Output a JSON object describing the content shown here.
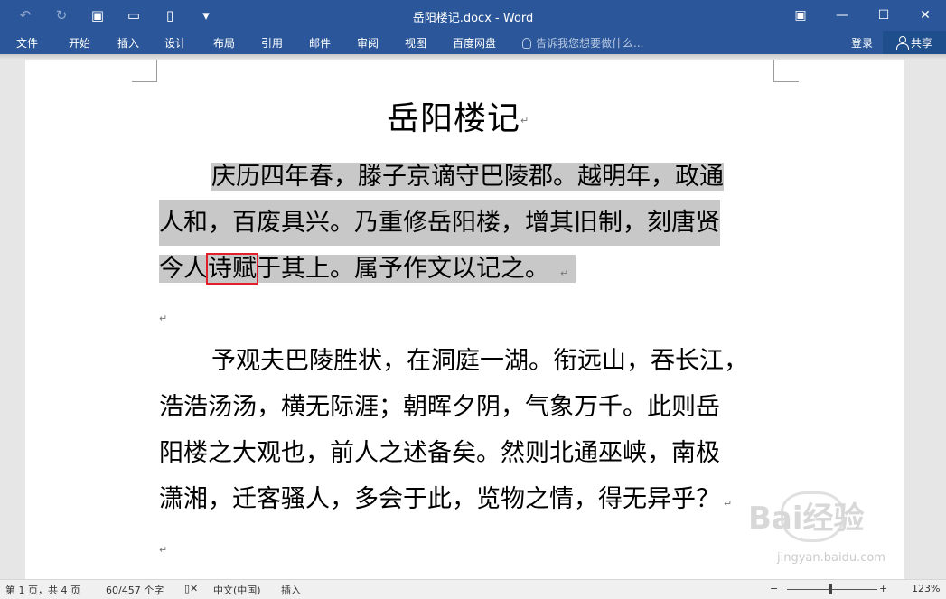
{
  "window": {
    "title": "岳阳楼记.docx - Word",
    "qat": [
      {
        "name": "undo-icon",
        "glyph": "↶"
      },
      {
        "name": "redo-icon",
        "glyph": "↻"
      },
      {
        "name": "save-icon",
        "glyph": "▣"
      },
      {
        "name": "open-folder-icon",
        "glyph": "▭"
      },
      {
        "name": "new-document-icon",
        "glyph": "▯"
      },
      {
        "name": "customize-qat-icon",
        "glyph": "▾"
      }
    ],
    "controls": [
      {
        "name": "ribbon-display-options-icon",
        "glyph": "▣"
      },
      {
        "name": "minimize-icon",
        "glyph": "—"
      },
      {
        "name": "maximize-icon",
        "glyph": "☐"
      },
      {
        "name": "close-icon",
        "glyph": "✕"
      }
    ]
  },
  "ribbon": {
    "tabs": [
      "文件",
      "开始",
      "插入",
      "设计",
      "布局",
      "引用",
      "邮件",
      "审阅",
      "视图",
      "百度网盘"
    ],
    "tell_me": "告诉我您想要做什么...",
    "login": "登录",
    "share": "共享"
  },
  "document": {
    "title": "岳阳楼记",
    "para1_lines": [
      "庆历四年春，滕子京谪守巴陵郡。越明年，政通",
      "人和，百废具兴。乃重修岳阳楼，增其旧制，刻唐贤"
    ],
    "para1_line3_before": "今人",
    "para1_line3_boxed": "诗赋",
    "para1_line3_after": "于其上。属予作文以记之。",
    "para2_lines": [
      "予观夫巴陵胜状，在洞庭一湖。衔远山，吞长江，",
      "浩浩汤汤，横无际涯；朝晖夕阴，气象万千。此则岳",
      "阳楼之大观也，前人之述备矣。然则北通巫峡，南极",
      "潇湘，迁客骚人，多会于此，览物之情，得无异乎？"
    ],
    "para_mark": "↵"
  },
  "watermark": {
    "text": "Bai经验",
    "sub": "jingyan.baidu.com"
  },
  "status": {
    "page": "第 1 页，共 4 页",
    "words": "60/457 个字",
    "language": "中文(中国)",
    "mode": "插入",
    "zoom": "123%",
    "zoom_minus": "−",
    "zoom_plus": "+"
  },
  "colors": {
    "title_bar": "#2b579a",
    "selection": "#c8c8c8",
    "highlight_box": "#e0202a"
  }
}
